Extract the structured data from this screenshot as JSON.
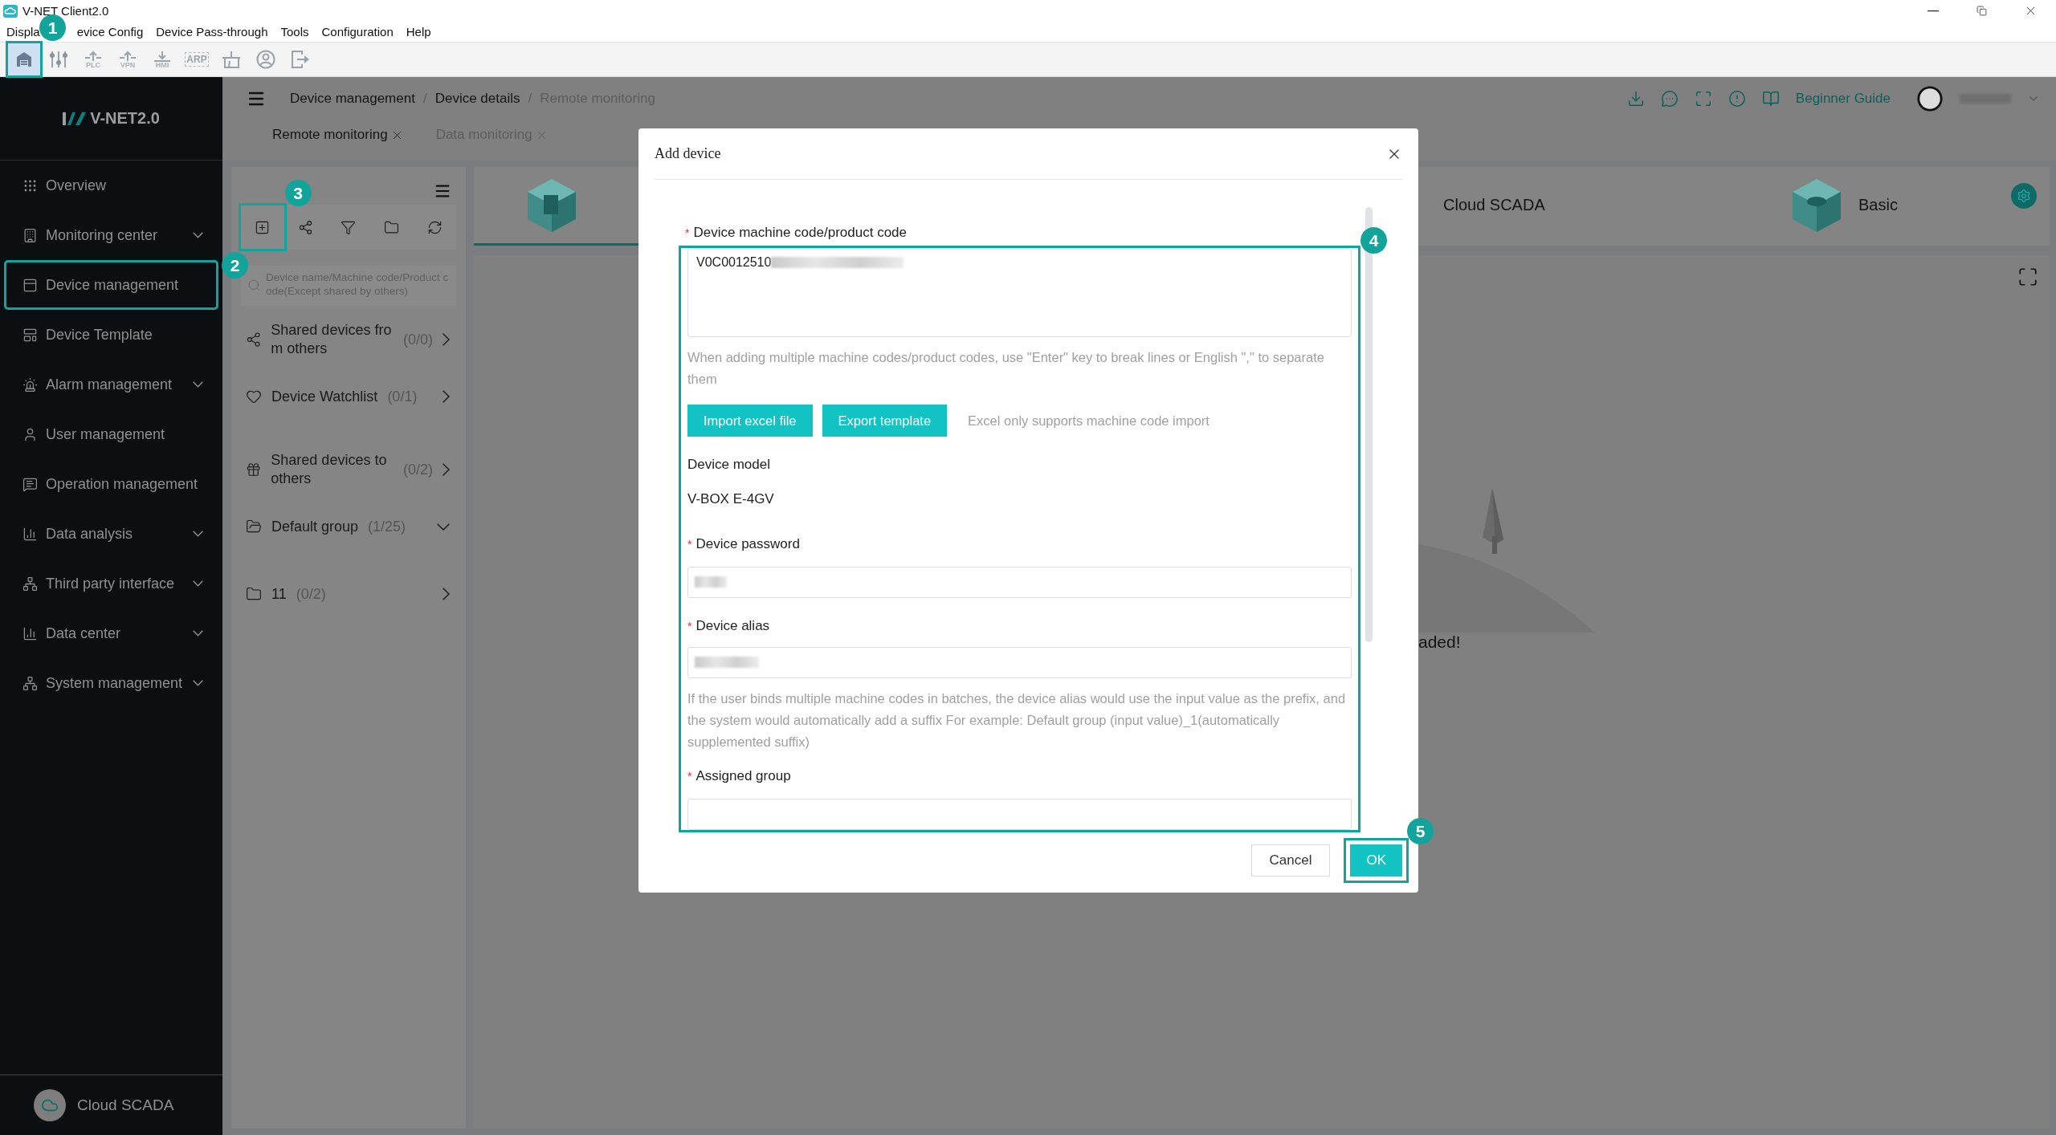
{
  "window": {
    "title": "V-NET Client2.0"
  },
  "menu_bar": [
    "Displa",
    "evice Config",
    "Device Pass-through",
    "Tools",
    "Configuration",
    "Help"
  ],
  "toolbar": [
    {
      "kind": "garage",
      "selected": true,
      "highlighted": true,
      "badge": "1"
    },
    {
      "kind": "sliders",
      "selected": false,
      "highlighted": false
    },
    {
      "kind": "upload",
      "label": "PLC",
      "selected": false,
      "highlighted": false
    },
    {
      "kind": "upload",
      "label": "VPN",
      "selected": false,
      "highlighted": false
    },
    {
      "kind": "download",
      "label": "HMI",
      "selected": false,
      "highlighted": false
    },
    {
      "kind": "text",
      "label": "ARP",
      "selected": false,
      "highlighted": false
    },
    {
      "kind": "tap",
      "selected": false,
      "highlighted": false
    },
    {
      "kind": "person",
      "selected": false,
      "highlighted": false
    },
    {
      "kind": "exit",
      "selected": false,
      "highlighted": false
    }
  ],
  "sidebar": {
    "logo": "V-NET2.0",
    "items": [
      {
        "label": "Overview",
        "has_submenu": false,
        "highlighted": false
      },
      {
        "label": "Monitoring center",
        "has_submenu": true,
        "highlighted": false
      },
      {
        "label": "Device management",
        "has_submenu": false,
        "highlighted": true,
        "badge": "2"
      },
      {
        "label": "Device Template",
        "has_submenu": false,
        "highlighted": false
      },
      {
        "label": "Alarm management",
        "has_submenu": true,
        "highlighted": false
      },
      {
        "label": "User management",
        "has_submenu": false,
        "highlighted": false
      },
      {
        "label": "Operation management",
        "has_submenu": false,
        "highlighted": false
      },
      {
        "label": "Data analysis",
        "has_submenu": true,
        "highlighted": false
      },
      {
        "label": "Third party interface",
        "has_submenu": true,
        "highlighted": false
      },
      {
        "label": "Data center",
        "has_submenu": true,
        "highlighted": false
      },
      {
        "label": "System management",
        "has_submenu": true,
        "highlighted": false
      }
    ],
    "footer": "Cloud SCADA"
  },
  "header": {
    "breadcrumb": [
      "Device management",
      "Device details",
      "Remote monitoring"
    ],
    "separator": "/",
    "tabs": [
      {
        "label": "Remote monitoring",
        "selected": true
      },
      {
        "label": "Data monitoring",
        "selected": false
      }
    ],
    "guide": "Beginner Guide",
    "user_redacted": true
  },
  "device_panel": {
    "tools": [
      {
        "highlighted": true,
        "badge": "3"
      },
      {
        "highlighted": false
      },
      {
        "highlighted": false
      },
      {
        "highlighted": false
      },
      {
        "highlighted": false
      }
    ],
    "search": {
      "placeholder": "Device name/Machine code/Product code(Except shared by others)"
    },
    "groups": [
      {
        "kind": "share",
        "label": "Shared devices from others",
        "count": "(0/0)",
        "expanded": false
      },
      {
        "kind": "heart",
        "label": "Device Watchlist",
        "count": "(0/1)",
        "expanded": false
      },
      {
        "kind": "gift",
        "label": "Shared devices to others",
        "count": "(0/2)",
        "expanded": false
      },
      {
        "kind": "folder",
        "label": "Default group",
        "count": "(1/25)",
        "expanded": true
      },
      {
        "kind": "folder",
        "label": "11",
        "count": "(0/2)",
        "expanded": false
      }
    ]
  },
  "templates": [
    {
      "selected": true,
      "icon_visible": true
    },
    {
      "label": "Cloud SCADA",
      "selected": false,
      "icon_visible": false
    },
    {
      "label": "Basic",
      "selected": false,
      "icon_visible": true
    }
  ],
  "empty_state": {
    "text": "aded!"
  },
  "dialog": {
    "title": "Add device",
    "highlighted": true,
    "badge": "4",
    "code_field": {
      "required_mark": "*",
      "label": "Device machine code/product code",
      "value": "V0C0012510",
      "redacted": true,
      "hint": "When adding multiple machine codes/product codes, use \"Enter\" key to break lines or English \",\" to separate them"
    },
    "import_buttons": [
      "Import excel file",
      "Export template"
    ],
    "import_note": "Excel only supports machine code import",
    "model": {
      "label": "Device model",
      "value": "V-BOX E-4GV"
    },
    "password": {
      "required_mark": "*",
      "label": "Device password",
      "redacted": true
    },
    "alias": {
      "required_mark": "*",
      "label": "Device alias",
      "redacted": true,
      "hint": "If the user binds multiple machine codes in batches, the device alias would use the input value as the prefix, and the system would automatically add a suffix For example: Default group (input value)_1(automatically supplemented suffix)"
    },
    "group": {
      "required_mark": "*",
      "label": "Assigned group"
    },
    "footer_buttons": [
      {
        "label": "Cancel",
        "kind": "default",
        "highlighted": false
      },
      {
        "label": "OK",
        "kind": "primary",
        "highlighted": true,
        "badge": "5"
      }
    ]
  }
}
